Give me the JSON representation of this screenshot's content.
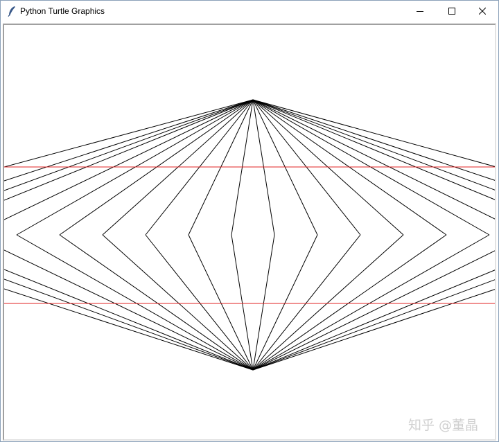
{
  "window": {
    "title": "Python Turtle Graphics",
    "icon": "feather-icon",
    "controls": {
      "minimize": "minimize-icon",
      "maximize": "maximize-icon",
      "close": "close-icon"
    }
  },
  "colors": {
    "line": "#000000",
    "guide": "#e02020",
    "background": "#ffffff"
  },
  "watermark": "知乎 @董晶"
}
